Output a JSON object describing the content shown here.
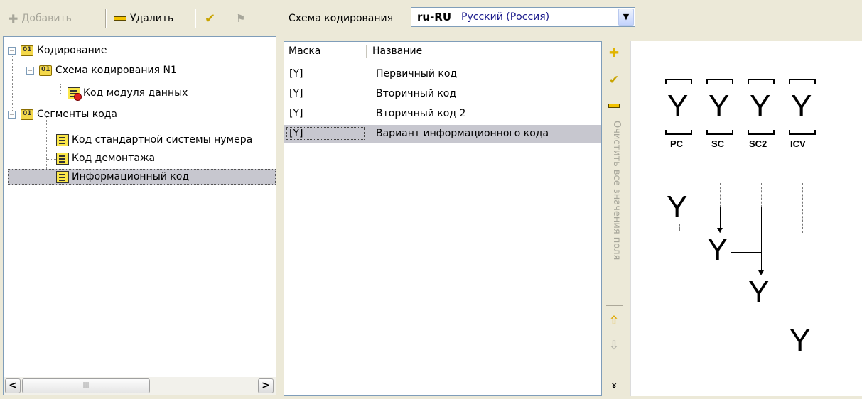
{
  "toolbar": {
    "add_label": "Добавить",
    "delete_label": "Удалить"
  },
  "tree": {
    "items": [
      {
        "label": "Кодирование"
      },
      {
        "label": "Схема кодирования N1"
      },
      {
        "label": "Код модуля данных"
      },
      {
        "label": "Сегменты кода"
      },
      {
        "label": "Код стандартной системы нумера"
      },
      {
        "label": "Код демонтажа"
      },
      {
        "label": "Информационный код"
      }
    ],
    "scroll_thumb": "|||"
  },
  "scheme": {
    "label": "Схема кодирования",
    "code": "ru-RU",
    "language": "Русский (Россия)"
  },
  "mask_table": {
    "headers": {
      "mask": "Маска",
      "name": "Название"
    },
    "rows": [
      {
        "mask": "[Y]",
        "name": "Первичный код"
      },
      {
        "mask": "[Y]",
        "name": "Вторичный код"
      },
      {
        "mask": "[Y]",
        "name": "Вторичный код 2"
      },
      {
        "mask": "[Y]",
        "name": "Вариант информационного кода"
      }
    ]
  },
  "side_toolbar": {
    "clear_label": "Очистить все значения поля",
    "collapse_glyph": "»"
  },
  "diagram": {
    "symbol": "Y",
    "labels": [
      "PC",
      "SC",
      "SC2",
      "ICV"
    ]
  },
  "colors": {
    "selection": "#c7c7cf",
    "panel_bg": "#ece9d8",
    "border": "#7f9db9",
    "language_text": "#1a1a8c"
  }
}
